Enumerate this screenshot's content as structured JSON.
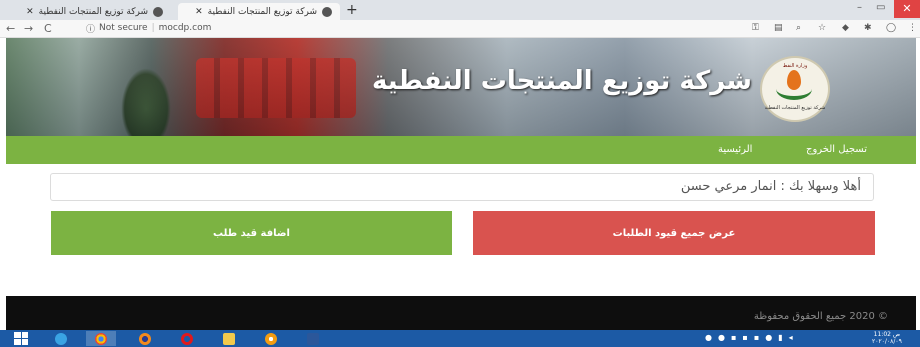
{
  "browser": {
    "tabs": [
      {
        "title": "شركة توزيع المنتجات النفطية",
        "active": false
      },
      {
        "title": "شركة توزيع المنتجات النفطية",
        "active": true
      }
    ],
    "new_tab": "+",
    "window_controls": {
      "minimize": "–",
      "maximize": "▭",
      "close": "✕"
    },
    "nav": {
      "back": "←",
      "forward": "→",
      "reload": "C"
    },
    "address": {
      "security_label": "Not secure",
      "url": "mocdp.com"
    }
  },
  "site": {
    "banner_title": "شركة توزيع المنتجات النفطية",
    "logo_top_text": "وزارة النفط",
    "logo_bottom_text": "شركة توزيع المنتجات النفطية",
    "menu": {
      "home": "الرئيسية",
      "logout": "تسجيل الخروج"
    },
    "welcome_text": "أهلا وسهلا بك : انمار مرعي حسن",
    "buttons": {
      "add_request": "اضافة قيد طلب",
      "view_all": "عرض جميع قيود الطلبات"
    },
    "footer_text": "© 2020 جميع الحقوق محفوظة"
  },
  "colors": {
    "green": "#7cb342",
    "red": "#d9534f",
    "footer": "#0e0e0e",
    "taskbar": "#1c5aa5"
  },
  "taskbar": {
    "apps": [
      "ie-icon",
      "chrome-icon",
      "firefox-icon",
      "opera-icon",
      "file-explorer-icon",
      "media-icon",
      "word-icon"
    ],
    "clock_time": "11:02 ص",
    "clock_date": "٢٠٢٠/٠٨/٠٩"
  }
}
